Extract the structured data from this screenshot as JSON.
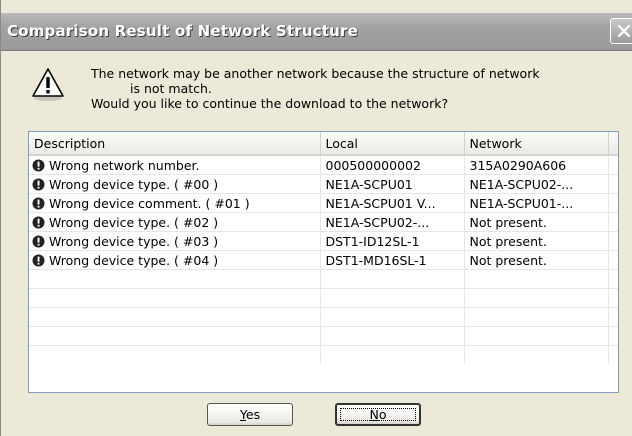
{
  "dialog": {
    "title": "Comparison Result of Network Structure",
    "close_icon": "close-icon"
  },
  "message": {
    "icon": "warning-icon",
    "line1": "The network may be another network because the structure of network",
    "line2": "is not match.",
    "line3": "Would you like to continue the download to the network?"
  },
  "table": {
    "columns": [
      "Description",
      "Local",
      "Network"
    ],
    "row_icon": "error-icon",
    "rows": [
      {
        "description": "Wrong network number.",
        "local": "000500000002",
        "network": "315A0290A606"
      },
      {
        "description": "Wrong device type. ( #00 )",
        "local": "NE1A-SCPU01",
        "network": "NE1A-SCPU02-..."
      },
      {
        "description": "Wrong device comment. ( #01 )",
        "local": "NE1A-SCPU01 V...",
        "network": "NE1A-SCPU01-..."
      },
      {
        "description": "Wrong device type. ( #02 )",
        "local": "NE1A-SCPU02-...",
        "network": "Not present."
      },
      {
        "description": "Wrong device type. ( #03 )",
        "local": "DST1-ID12SL-1",
        "network": "Not present."
      },
      {
        "description": "Wrong device type. ( #04 )",
        "local": "DST1-MD16SL-1",
        "network": "Not present."
      }
    ]
  },
  "buttons": {
    "yes_underlined": "Y",
    "yes_rest": "es",
    "no_underlined": "N",
    "no_rest": "o"
  }
}
